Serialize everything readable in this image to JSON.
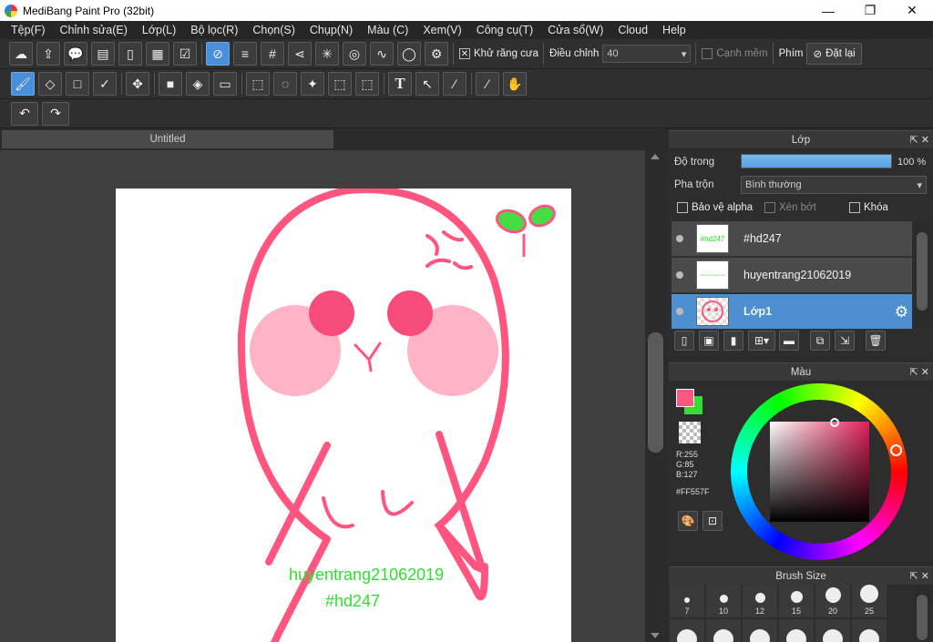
{
  "window": {
    "title": "MediBang Paint Pro (32bit)",
    "controls": {
      "minimize": "—",
      "maximize": "❐",
      "close": "✕"
    }
  },
  "menu": [
    "Tệp(F)",
    "Chỉnh sửa(E)",
    "Lớp(L)",
    "Bộ lọc(R)",
    "Chọn(S)",
    "Chụp(N)",
    "Màu (C)",
    "Xem(V)",
    "Công cụ(T)",
    "Cửa sổ(W)",
    "Cloud",
    "Help"
  ],
  "toolbar1": {
    "antialias_label": "Khử răng cưa",
    "antialias_checked": "✕",
    "adjust_label": "Điều chỉnh",
    "adjust_value": "40",
    "soft_edge_label": "Cạnh mềm",
    "key_label": "Phím",
    "reset_label": "Đặt lại"
  },
  "document": {
    "tab_title": "Untitled"
  },
  "canvas": {
    "text1": "huyentrang21062019",
    "text2": "#hd247",
    "text_color": "#33dd33",
    "stroke_color": "#ff557f"
  },
  "layers_panel": {
    "title": "Lớp",
    "opacity_label": "Độ trong",
    "opacity_value": "100 %",
    "opacity": 1.0,
    "blend_label": "Pha trộn",
    "blend_value": "Bình thường",
    "protect_alpha": "Bảo vệ alpha",
    "clipping": "Xén bớt",
    "lock": "Khóa",
    "layers": [
      {
        "name": "#hd247",
        "thumb_text": "#hd247",
        "selected": false
      },
      {
        "name": "huyentrang21062019",
        "thumb_text": "~~~~~~",
        "selected": false
      },
      {
        "name": "Lớp1",
        "thumb_text": "",
        "selected": true
      }
    ]
  },
  "color_panel": {
    "title": "Màu",
    "r": "R:255",
    "g": "G:85",
    "b": "B:127",
    "hex": "#FF557F",
    "primary": "#ff557f",
    "secondary": "#33dd33"
  },
  "brush_panel": {
    "title": "Brush Size",
    "sizes": [
      "7",
      "10",
      "12",
      "15",
      "20",
      "25"
    ]
  }
}
